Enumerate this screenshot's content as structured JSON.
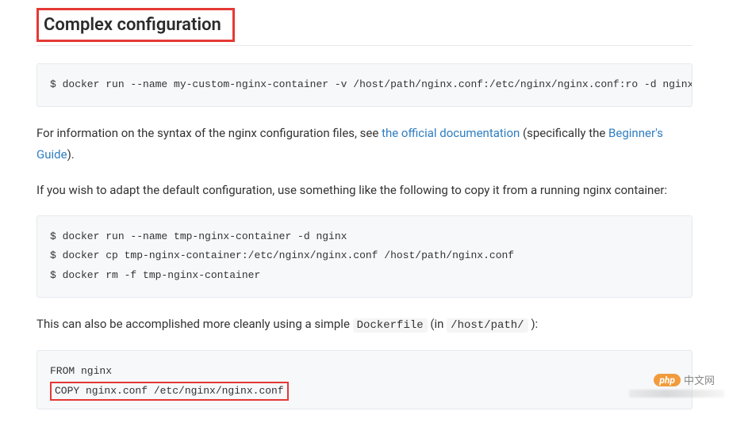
{
  "heading": "Complex configuration",
  "code1": "$ docker run --name my-custom-nginx-container -v /host/path/nginx.conf:/etc/nginx/nginx.conf:ro -d nginx",
  "para1_pre": "For information on the syntax of the nginx configuration files, see ",
  "link1": "the official documentation",
  "para1_mid": " (specifically the ",
  "link2": "Beginner's Guide",
  "para1_post": ").",
  "para2": "If you wish to adapt the default configuration, use something like the following to copy it from a running nginx container:",
  "code2": "$ docker run --name tmp-nginx-container -d nginx\n$ docker cp tmp-nginx-container:/etc/nginx/nginx.conf /host/path/nginx.conf\n$ docker rm -f tmp-nginx-container",
  "para3_pre": "This can also be accomplished more cleanly using a simple ",
  "inline1": "Dockerfile",
  "para3_mid": " (in ",
  "inline2": "/host/path/",
  "para3_post": " ):",
  "code3_line1": "FROM nginx",
  "code3_line2": "COPY nginx.conf /etc/nginx/nginx.conf",
  "watermark_logo": "php",
  "watermark_text": "中文网"
}
